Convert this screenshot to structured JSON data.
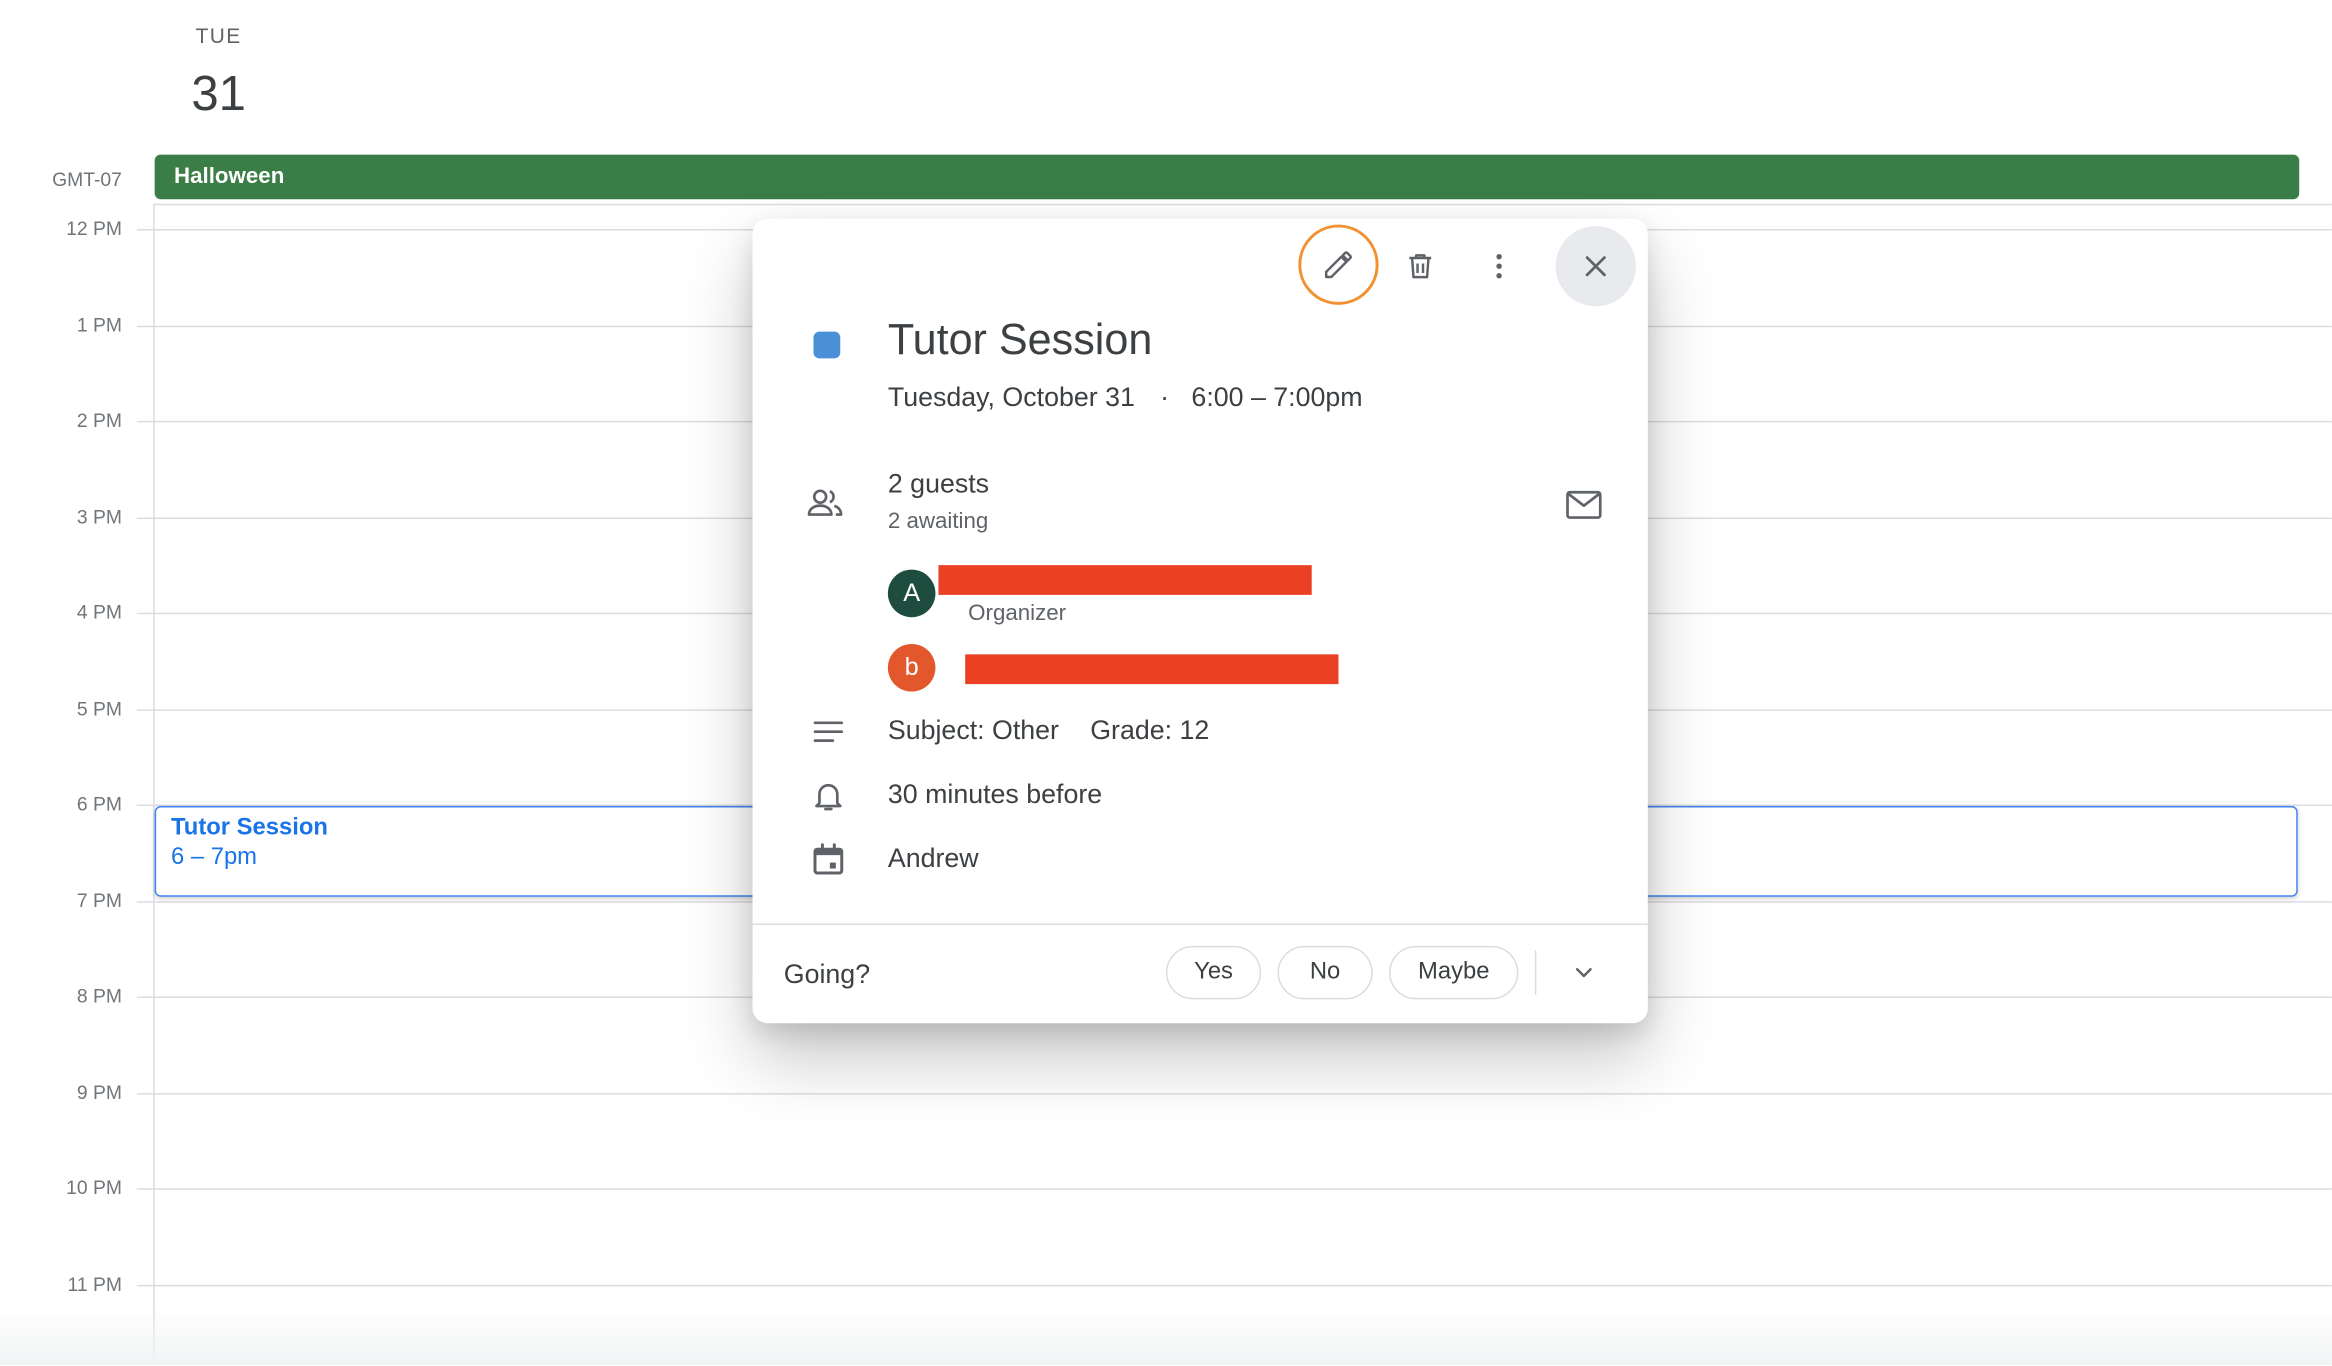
{
  "day_header": {
    "weekday": "TUE",
    "day_number": "31"
  },
  "timezone": "GMT-07",
  "all_day_event": {
    "title": "Halloween",
    "color": "#3b7d46"
  },
  "hours": [
    "12 PM",
    "1 PM",
    "2 PM",
    "3 PM",
    "4 PM",
    "5 PM",
    "6 PM",
    "7 PM",
    "8 PM",
    "9 PM",
    "10 PM",
    "11 PM"
  ],
  "calendar_event": {
    "title": "Tutor Session",
    "time": "6 – 7pm",
    "color": "#1a73e8"
  },
  "popup": {
    "toolbar": {
      "edit_icon": "pencil-icon",
      "delete_icon": "trash-icon",
      "more_icon": "more-vert-icon",
      "close_icon": "close-icon",
      "highlight_color": "#f29130"
    },
    "event_color": "#4a90d9",
    "title": "Tutor Session",
    "date": "Tuesday, October 31",
    "separator": "·",
    "time": "6:00 – 7:00pm",
    "guests": {
      "count_label": "2 guests",
      "status_label": "2 awaiting",
      "list": [
        {
          "initial": "A",
          "role": "Organizer",
          "avatar_color": "#1e4d3f"
        },
        {
          "initial": "b",
          "role": "",
          "avatar_color": "#e2572c"
        }
      ]
    },
    "description": {
      "subject": "Subject: Other",
      "grade": "Grade: 12"
    },
    "reminder": "30 minutes before",
    "calendar_owner": "Andrew",
    "rsvp": {
      "question": "Going?",
      "options": [
        "Yes",
        "No",
        "Maybe"
      ]
    }
  }
}
